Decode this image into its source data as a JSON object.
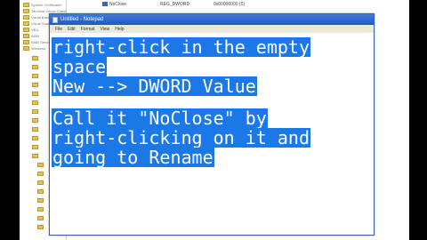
{
  "window": {
    "title": "Untitled - Notepad"
  },
  "menu": [
    "File",
    "Edit",
    "Format",
    "View",
    "Help"
  ],
  "registry_tree": [
    "System Certificates",
    "Terminal Server Client",
    "Visual Basic",
    "Visual Studio",
    "VBA",
    "WAB",
    "WAB Services",
    "Windows"
  ],
  "registry_value": {
    "name": "NoClose",
    "type": "REG_DWORD",
    "data": "0x00000000 (0)"
  },
  "notepad_text": {
    "line1": "right-click in the empty",
    "line2": "space",
    "line3": "New --> DWORD Value",
    "line4": "Call it \"NoClose\" by",
    "line5": "right-clicking on it and",
    "line6": "going to Rename"
  },
  "colors": {
    "highlight": "#1b78e7",
    "titlebar": "#2157c4"
  }
}
